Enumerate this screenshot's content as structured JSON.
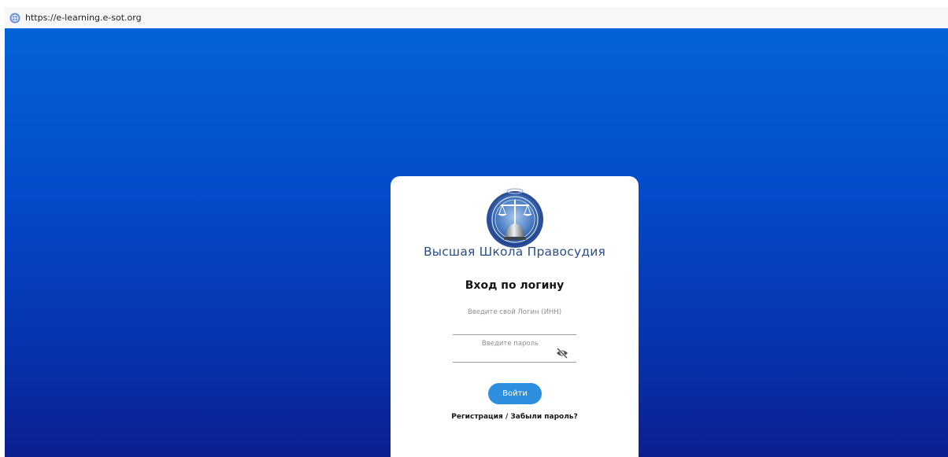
{
  "browser": {
    "url": "https://e-learning.e-sot.org",
    "site_icon": "globe-icon"
  },
  "login_card": {
    "logo": "scales-of-justice-emblem",
    "org_name": "Высшая Школа Правосудия",
    "title": "Вход по логину",
    "login_field": {
      "placeholder": "Введите свой Логин (ИНН)",
      "value": ""
    },
    "password_field": {
      "placeholder": "Введите пароль",
      "value": "",
      "toggle_icon": "eye-slash-icon"
    },
    "submit_label": "Войти",
    "register_label": "Регистрация",
    "separator": " / ",
    "forgot_label": "Забыли пароль?"
  },
  "colors": {
    "background_top": "#0363d8",
    "background_bottom": "#0b1f8f",
    "button": "#2e8fe1",
    "org_name": "#2a4f87"
  }
}
